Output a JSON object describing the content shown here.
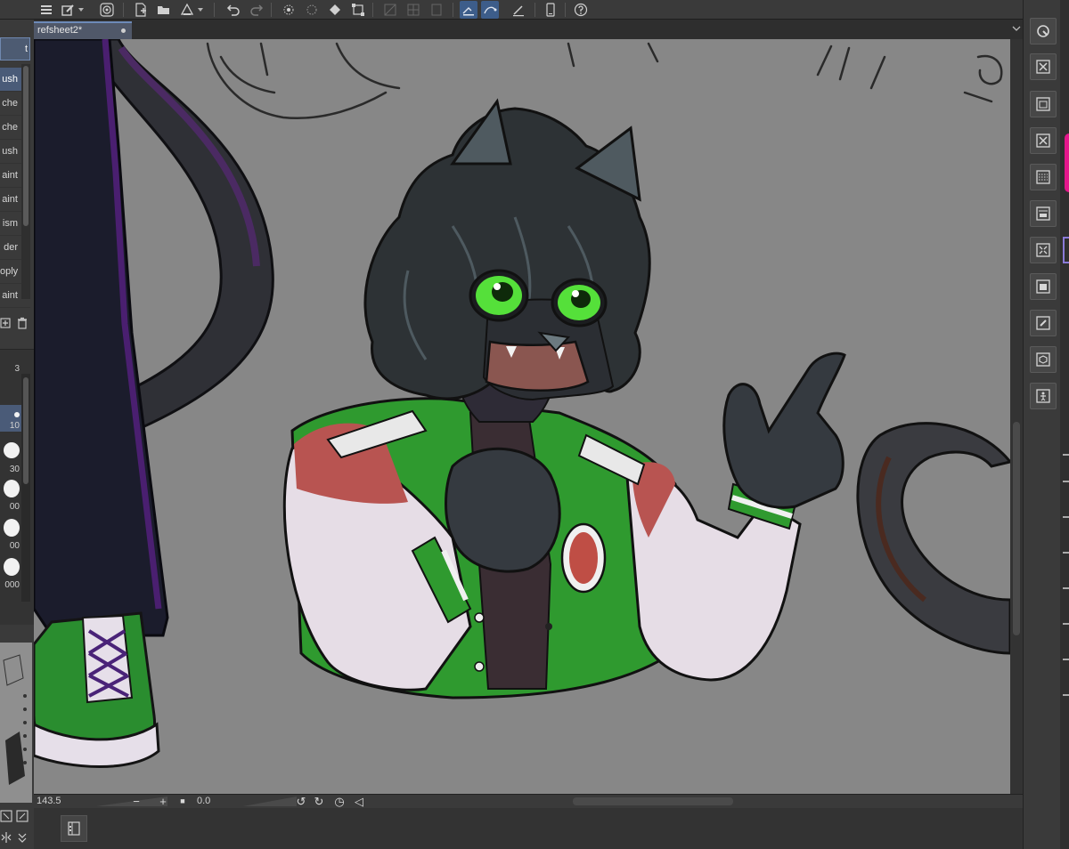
{
  "document": {
    "tab_title": "refsheet2*"
  },
  "sub_tool_panel": {
    "header_label": "t",
    "items": [
      {
        "label": "ush",
        "selected": true
      },
      {
        "label": "che",
        "selected": false
      },
      {
        "label": "che",
        "selected": false
      },
      {
        "label": "ush",
        "selected": false
      },
      {
        "label": "aint",
        "selected": false
      },
      {
        "label": "aint",
        "selected": false
      },
      {
        "label": "ism",
        "selected": false
      },
      {
        "label": "der",
        "selected": false
      },
      {
        "label": "oply",
        "selected": false
      },
      {
        "label": "aint",
        "selected": false
      }
    ]
  },
  "brush_size_panel": {
    "top_label": "3",
    "items": [
      {
        "value": "10",
        "selected": true
      },
      {
        "value": "30",
        "selected": false
      },
      {
        "value": "00",
        "selected": false
      },
      {
        "value": "00",
        "selected": false
      },
      {
        "value": "000",
        "selected": false
      }
    ]
  },
  "status_bar": {
    "zoom": "143.5",
    "rotation": "0.0"
  },
  "colors": {
    "canvas_bg": "#878787",
    "accent": "#3d5d8a",
    "magenta": "#e4178c",
    "jacket_green": "#2f9a2f"
  },
  "icons": {
    "command_bar": [
      "menu-icon",
      "pen-settings-icon",
      "spiral-icon",
      "new-icon",
      "open-icon",
      "save-icon",
      "undo-icon",
      "redo-icon",
      "sparkle-icon",
      "selection-icon",
      "fill-icon",
      "transform-icon",
      "ruler-icon",
      "grid-icon",
      "perspective-icon",
      "stabilizer-icon",
      "vector-icon",
      "snap-icon",
      "device-icon",
      "help-icon"
    ],
    "right_dock": [
      "navigator-icon",
      "close-layer-icon",
      "library-icon",
      "close-layer-icon",
      "pattern-icon",
      "layer-properties-icon",
      "transform-layer-icon",
      "folder-icon",
      "edit-icon",
      "3d-icon",
      "figure-icon"
    ]
  }
}
